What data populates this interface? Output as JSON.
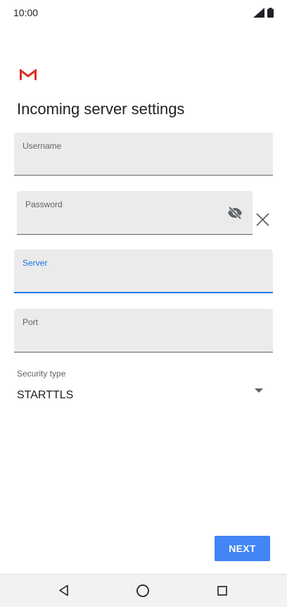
{
  "status_bar": {
    "time": "10:00"
  },
  "page": {
    "title": "Incoming server settings"
  },
  "form": {
    "username": {
      "label": "Username",
      "value": ""
    },
    "password": {
      "label": "Password",
      "value": ""
    },
    "server": {
      "label": "Server",
      "value": ""
    },
    "port": {
      "label": "Port",
      "value": ""
    },
    "security_type": {
      "label": "Security type",
      "value": "STARTTLS"
    }
  },
  "actions": {
    "next_label": "NEXT"
  },
  "colors": {
    "accent": "#1a73e8",
    "button": "#4285f4",
    "field_bg": "#ebebeb",
    "gmail_red": "#d93025"
  },
  "icons": [
    "gmail-logo",
    "signal-icon",
    "battery-icon",
    "visibility-off-icon",
    "clear-icon",
    "dropdown-arrow-icon",
    "back-icon",
    "home-icon",
    "recents-icon"
  ]
}
